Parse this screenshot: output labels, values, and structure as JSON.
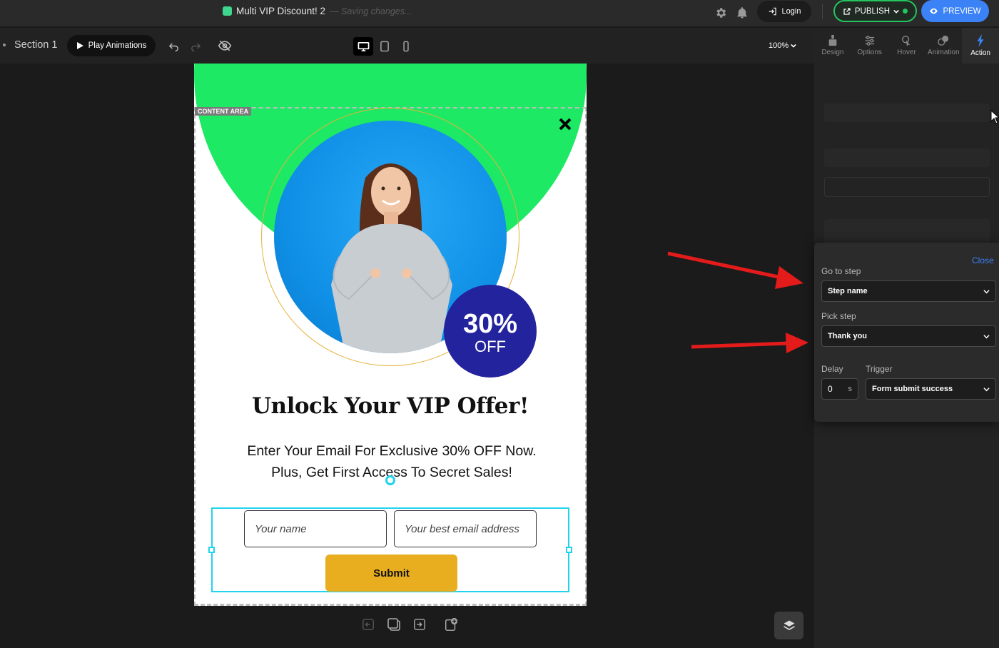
{
  "topbar": {
    "doc_title": "Multi VIP Discount! 2",
    "saving_status": "— Saving changes...",
    "login_label": "Login",
    "publish_label": "PUBLISH",
    "preview_label": "PREVIEW"
  },
  "subbar": {
    "section_label": "Section 1",
    "play_label": "Play Animations",
    "zoom_label": "100%"
  },
  "panel": {
    "tabs": [
      {
        "label": "Design",
        "icon": "paint-brush-icon"
      },
      {
        "label": "Options",
        "icon": "sliders-icon"
      },
      {
        "label": "Hover",
        "icon": "cursor-icon"
      },
      {
        "label": "Animation",
        "icon": "animation-icon"
      },
      {
        "label": "Action",
        "icon": "lightning-icon"
      }
    ],
    "active_tab": "Action"
  },
  "popover": {
    "close_label": "Close",
    "goto_label": "Go to step",
    "goto_value": "Step name",
    "pick_label": "Pick step",
    "pick_value": "Thank you",
    "delay_label": "Delay",
    "delay_value": "0",
    "delay_unit": "s",
    "trigger_label": "Trigger",
    "trigger_value": "Form submit success"
  },
  "canvas": {
    "content_tag": "CONTENT AREA",
    "badge_pct": "30%",
    "badge_off": "OFF",
    "headline": "Unlock Your VIP Offer!",
    "subtext_line1": "Enter Your Email For Exclusive 30% OFF Now.",
    "subtext_line2": "Plus, Get First Access To Secret Sales!",
    "name_placeholder": "Your name",
    "email_placeholder": "Your best email address",
    "submit_label": "Submit"
  },
  "colors": {
    "accent_blue": "#3b82f6",
    "publish_green": "#22c55e",
    "blob_green": "#1de964",
    "badge_navy": "#24239e",
    "submit_gold": "#e8ae1f",
    "selection_cyan": "#22d3ee",
    "arrow_red": "#e31b1b"
  }
}
